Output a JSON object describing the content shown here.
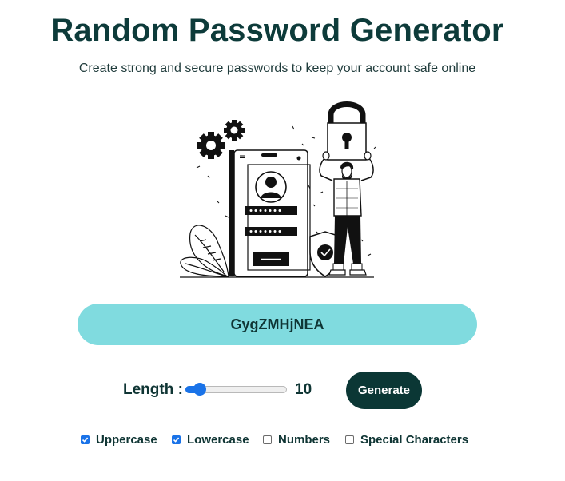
{
  "header": {
    "title": "Random Password Generator",
    "subtitle": "Create strong and secure passwords to keep your account safe online"
  },
  "password": {
    "value": "GygZMHjNEA"
  },
  "length": {
    "label": "Length :",
    "value": "10",
    "slider_fraction": 0.09
  },
  "generate": {
    "label": "Generate"
  },
  "options": [
    {
      "label": "Uppercase",
      "checked": true
    },
    {
      "label": "Lowercase",
      "checked": true
    },
    {
      "label": "Numbers",
      "checked": false
    },
    {
      "label": "Special Characters",
      "checked": false
    }
  ],
  "colors": {
    "title": "#0d3b3a",
    "password_bg": "#80dbdf",
    "button_bg": "#0b3735",
    "accent": "#1a73e8"
  }
}
